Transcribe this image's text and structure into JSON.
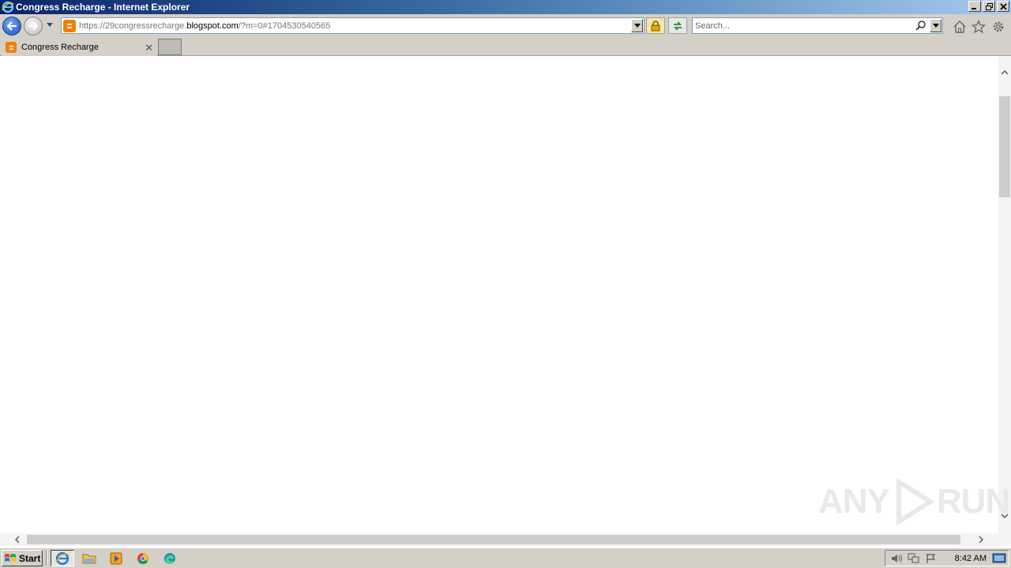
{
  "window": {
    "title": "Congress Recharge - Internet Explorer",
    "minimize_symbol": "_",
    "close_symbol": "✕"
  },
  "nav": {
    "url_prefix": "https://29congressrecharge.",
    "url_domain": "blogspot.com",
    "url_suffix": "/?m=0#1704530540565",
    "search_placeholder": "Search..."
  },
  "tabs": [
    {
      "label": "Congress Recharge",
      "active": true,
      "favicon": "blogger-icon"
    }
  ],
  "tab_close_symbol": "✕",
  "taskbar": {
    "start_label": "Start",
    "apps": [
      "internet-explorer-icon",
      "file-explorer-icon",
      "media-player-icon",
      "chrome-icon",
      "edge-icon"
    ],
    "clock": "8:42 AM"
  },
  "watermark": {
    "left": "ANY",
    "right": "RUN"
  },
  "colors": {
    "blogger_orange": "#f57d00",
    "titlebar_start": "#0a246a",
    "titlebar_end": "#a6caf0",
    "chrome_gray": "#d4d0c8"
  }
}
